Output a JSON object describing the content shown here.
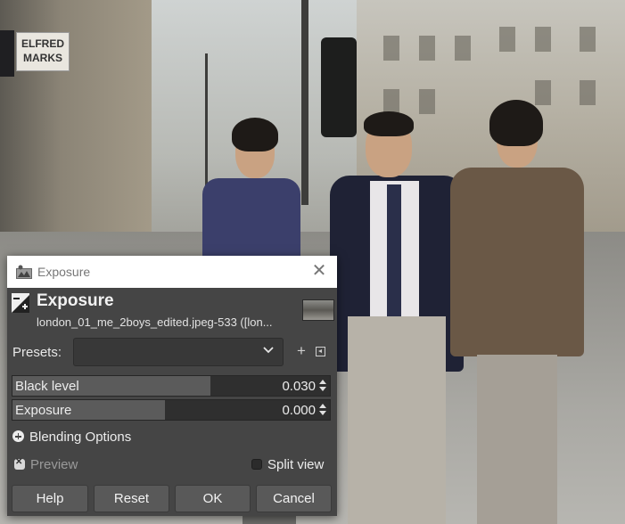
{
  "background": {
    "sign_text": "ELFRED\nMARKS"
  },
  "dialog": {
    "window_title": "Exposure",
    "close_glyph": "✕",
    "tool_title": "Exposure",
    "image_subtitle": "london_01_me_2boys_edited.jpeg-533 ([lon...",
    "presets_label": "Presets:",
    "presets_value": "",
    "add_preset_glyph": "+",
    "sliders": [
      {
        "label": "Black level",
        "value": "0.030",
        "fill_fraction": 0.62
      },
      {
        "label": "Exposure",
        "value": "0.000",
        "fill_fraction": 0.48
      }
    ],
    "blending_options_label": "Blending Options",
    "preview_label": "Preview",
    "preview_checked": true,
    "split_view_label": "Split view",
    "split_view_checked": false,
    "buttons": {
      "help": "Help",
      "reset": "Reset",
      "ok": "OK",
      "cancel": "Cancel"
    }
  },
  "colors": {
    "dialog_bg": "#454545",
    "titlebar_bg": "#ffffff",
    "button_bg": "#595959",
    "slider_fill": "#5b5b5b"
  }
}
